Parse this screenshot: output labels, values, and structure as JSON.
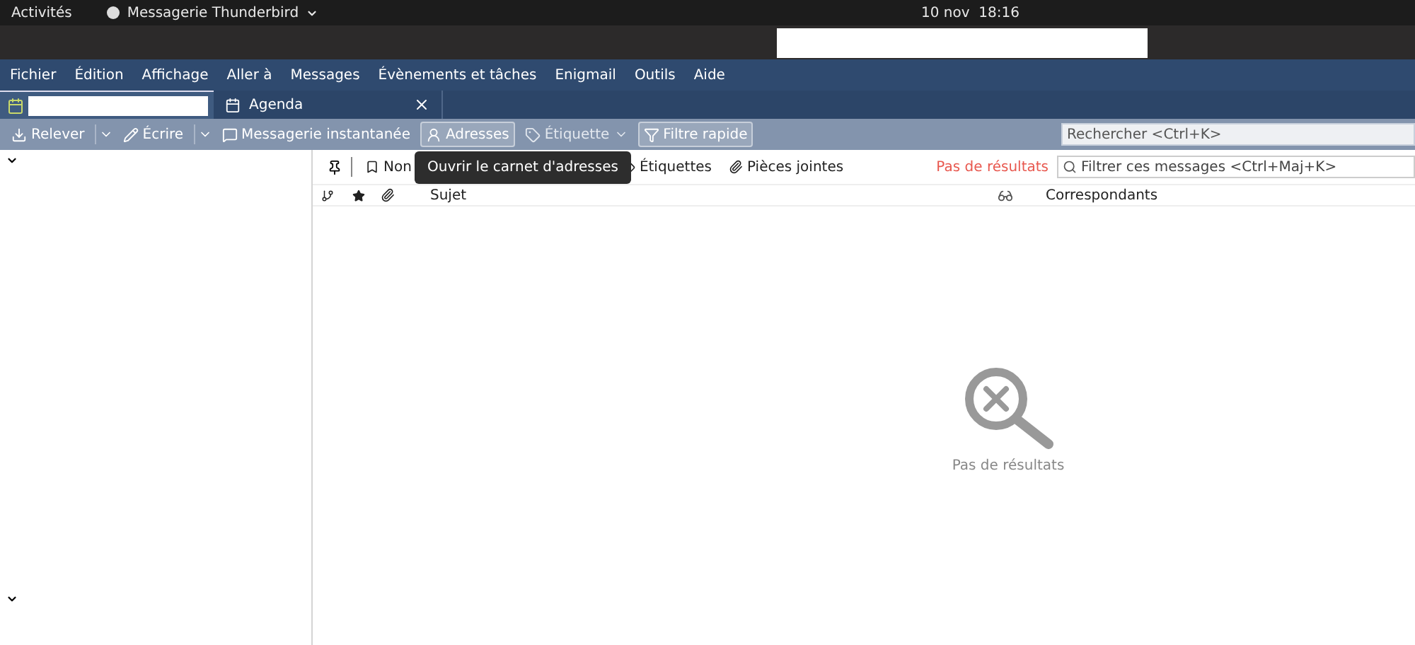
{
  "topbar": {
    "activities": "Activités",
    "app_menu": "Messagerie Thunderbird",
    "clock": "10 nov  18:16"
  },
  "menubar": [
    {
      "label": "Fichier"
    },
    {
      "label": "Édition"
    },
    {
      "label": "Affichage"
    },
    {
      "label": "Aller à"
    },
    {
      "label": "Messages"
    },
    {
      "label": "Évènements et tâches"
    },
    {
      "label": "Enigmail"
    },
    {
      "label": "Outils"
    },
    {
      "label": "Aide"
    }
  ],
  "tabs": [
    {
      "kind": "mail",
      "selected": true
    },
    {
      "kind": "calendar",
      "label": "Agenda",
      "selected": false
    }
  ],
  "toolbar": {
    "buttons": [
      {
        "kind": "get",
        "label": "Relever",
        "menu": true
      },
      {
        "kind": "write",
        "label": "Écrire",
        "menu": true
      },
      {
        "kind": "chat",
        "label": "Messagerie instantanée"
      },
      {
        "kind": "address",
        "label": "Adresses",
        "pressed": true
      },
      {
        "kind": "tag",
        "label": "Étiquette",
        "disabled": true,
        "menu": true
      },
      {
        "kind": "filter",
        "label": "Filtre rapide",
        "checked": true
      }
    ],
    "search": {
      "placeholder": "Rechercher <Ctrl+K>"
    }
  },
  "quick_filter": {
    "buttons": [
      {
        "kind": "unread",
        "label": "Non"
      },
      {
        "kind": "tags",
        "label": "Étiquettes"
      },
      {
        "kind": "attachments",
        "label": "Pièces jointes"
      }
    ],
    "status": "Pas de résultats",
    "filter": {
      "placeholder": "Filtrer ces messages <Ctrl+Maj+K>"
    }
  },
  "tooltip": "Ouvrir le carnet d'adresses",
  "columns": [
    {
      "kind": "thread"
    },
    {
      "kind": "star"
    },
    {
      "kind": "attachment"
    },
    {
      "kind": "text",
      "label": "Sujet"
    },
    {
      "kind": "read"
    },
    {
      "kind": "text",
      "label": "Correspondants"
    }
  ],
  "empty": {
    "message": "Pas de résultats"
  }
}
